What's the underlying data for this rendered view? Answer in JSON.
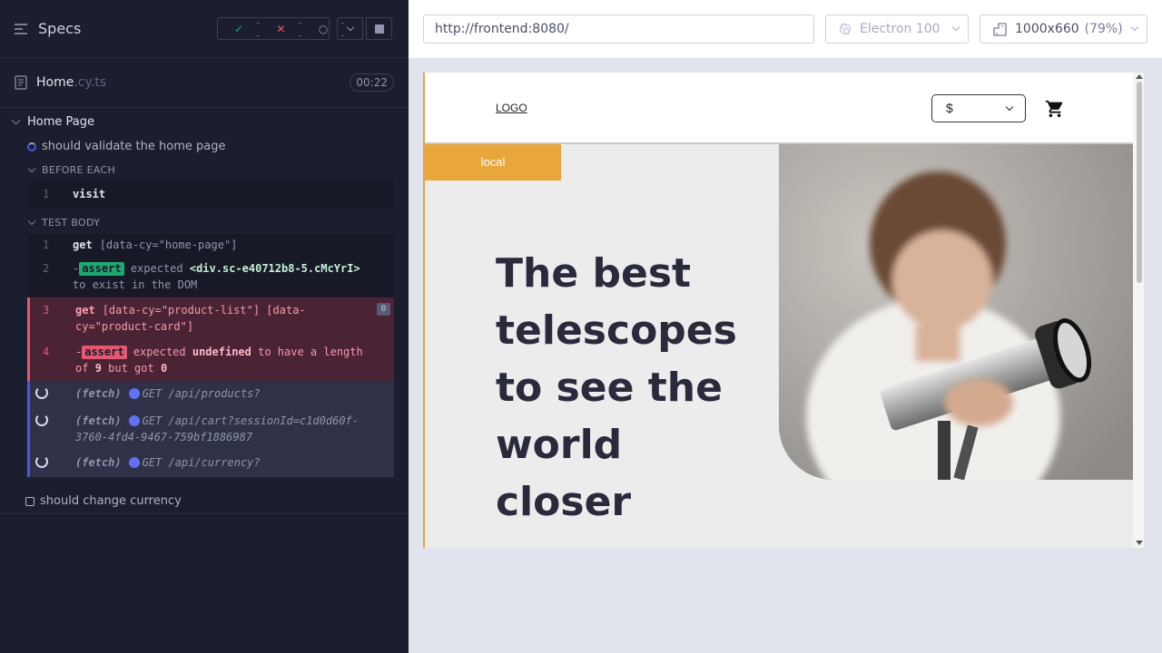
{
  "reporter": {
    "title": "Specs",
    "stats": {
      "passed": "--",
      "failed": "--",
      "pending": "--"
    },
    "spec": {
      "name": "Home",
      "ext": ".cy.ts",
      "duration": "00:22"
    },
    "suite": "Home Page",
    "test1": "should validate the home page",
    "before_each": "BEFORE EACH",
    "test_body": "TEST BODY",
    "test2": "should change currency",
    "commands_before": [
      {
        "num": "1",
        "name": "visit"
      }
    ],
    "commands": [
      {
        "num": "1",
        "name": "get",
        "msg": "[data-cy=\"home-page\"]"
      },
      {
        "num": "2",
        "dash": "-",
        "badge": "assert",
        "expected": "expected",
        "subject": "<div.sc-e40712b8-5.cMcYrI>",
        "tail": "to exist in the DOM"
      },
      {
        "num": "3",
        "name": "get",
        "msg": "[data-cy=\"product-list\"] [data-cy=\"product-card\"]",
        "count": "0"
      },
      {
        "num": "4",
        "dash": "-",
        "badge": "assert",
        "expected": "expected",
        "subject": "undefined",
        "mid": "to have a length of",
        "n1": "9",
        "but": "but got",
        "n2": "0"
      }
    ],
    "fetches": [
      {
        "label": "(fetch)",
        "path": "GET /api/products?"
      },
      {
        "label": "(fetch)",
        "path": "GET /api/cart?sessionId=c1d0d60f-3760-4fd4-9467-759bf1886987"
      },
      {
        "label": "(fetch)",
        "path": "GET /api/currency?"
      }
    ]
  },
  "runner": {
    "url": "http://frontend:8080/",
    "browser": "Electron 100",
    "viewport": "1000x660",
    "zoom": "(79%)"
  },
  "app": {
    "logo": "LOGO",
    "currency": "$",
    "locale_badge": "local",
    "hero_lines": [
      "The best",
      "telescopes",
      "to see the",
      "world",
      "closer"
    ]
  },
  "colors": {
    "accent": "#e8a63b",
    "pass": "#1fa971",
    "fail": "#e45770",
    "fetch": "#4956e3"
  }
}
